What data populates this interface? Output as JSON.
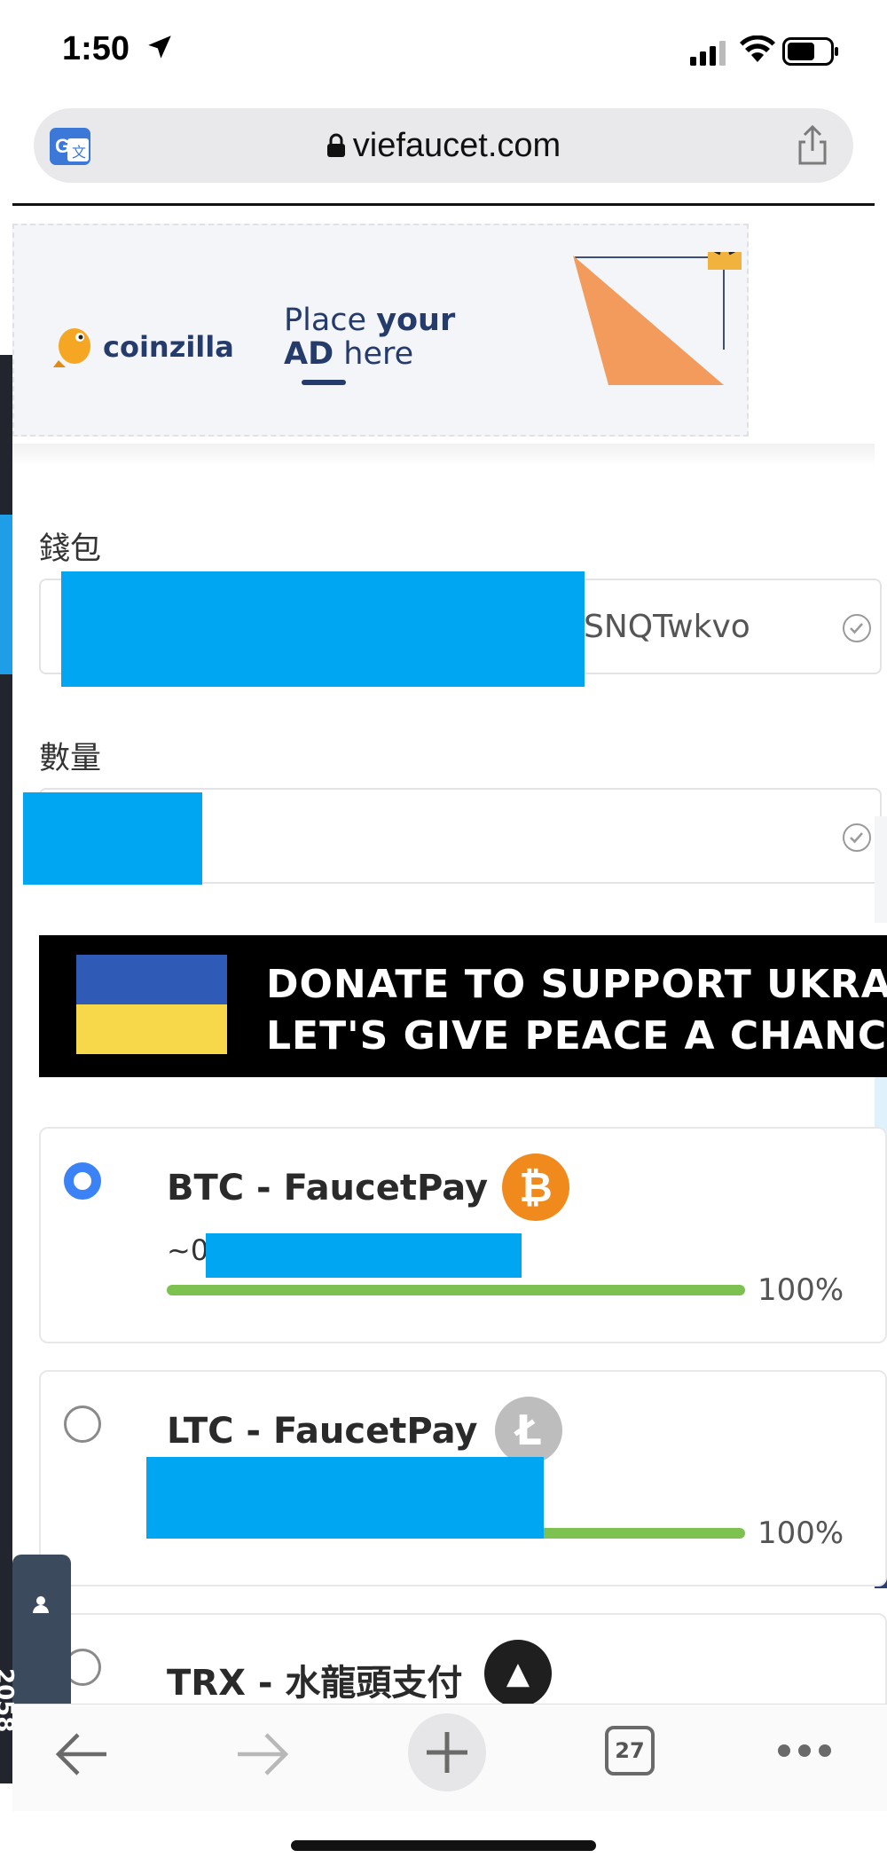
{
  "status_bar": {
    "time": "1:50"
  },
  "browser": {
    "url": "viefaucet.com",
    "tab_count": "27"
  },
  "ad": {
    "brand": "coinzilla",
    "line1_a": "Place ",
    "line1_b": "your",
    "line2_a": "AD",
    "line2_b": " here"
  },
  "form": {
    "wallet_label": "錢包",
    "wallet_value_tail": "SNQTwkvo",
    "amount_label": "數量"
  },
  "banner": {
    "line1": "DONATE TO SUPPORT UKRAIN",
    "line2": "LET'S GIVE PEACE A CHANC"
  },
  "options": [
    {
      "title": "BTC - FaucetPay",
      "amount_prefix": "~0.",
      "percent": "100%",
      "selected": true,
      "coin_symbol": "₿",
      "coin_color": "#f08a1c",
      "fill": 1.0
    },
    {
      "title": "LTC - FaucetPay",
      "percent": "100%",
      "selected": false,
      "coin_symbol": "Ł",
      "coin_color": "#bdbdbd",
      "fill": 1.0
    },
    {
      "title": "TRX - 水龍頭支付",
      "selected": false,
      "coin_symbol": "▲",
      "coin_color": "#1f1f1f"
    }
  ],
  "side_widget": {
    "count": "2058"
  },
  "colors": {
    "accent": "#3b82f6",
    "redaction": "#00a6f1",
    "progress": "#7dc151"
  }
}
